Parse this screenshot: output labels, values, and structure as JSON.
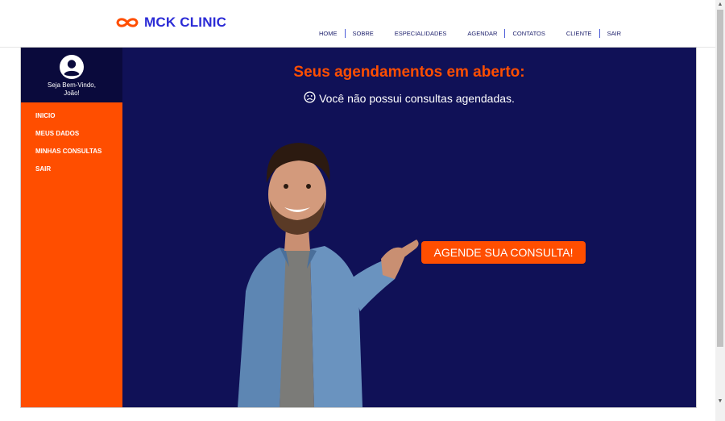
{
  "brand": {
    "name": "MCK CLINIC",
    "accent": "#ff4e00",
    "logo_icon": "infinity-icon"
  },
  "nav": {
    "items": [
      "HOME",
      "SOBRE",
      "ESPECIALIDADES",
      "AGENDAR",
      "CONTATOS",
      "CLIENTE",
      "SAIR"
    ]
  },
  "sidebar": {
    "welcome_line1": "Seja Bem-Vindo,",
    "welcome_line2": "João!",
    "avatar_icon": "user-circle-icon",
    "menu": [
      "INICIO",
      "MEUS DADOS",
      "MINHAS CONSULTAS",
      "SAIR"
    ]
  },
  "main": {
    "heading": "Seus agendamentos em aberto:",
    "status_icon": "sad-face-icon",
    "no_appointments": "Você não possui consultas agendadas.",
    "cta_label": "AGENDE SUA CONSULTA!"
  },
  "colors": {
    "primary": "#ff4e00",
    "dark": "#101157",
    "darker": "#0a0a3c",
    "brand_blue": "#2b2bd6"
  }
}
